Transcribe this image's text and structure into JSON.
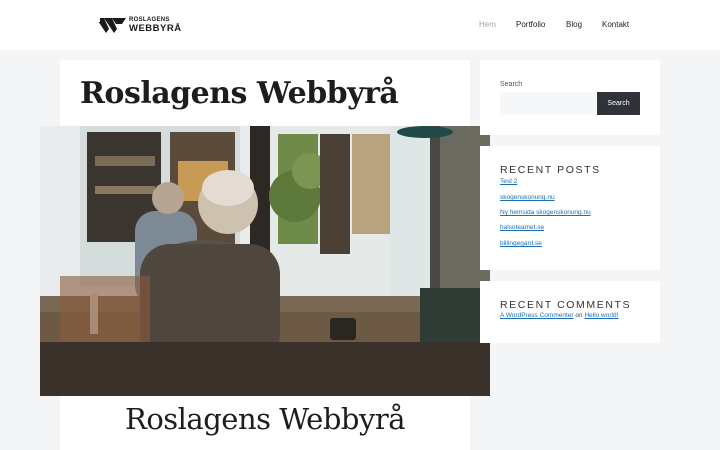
{
  "header": {
    "logo": {
      "top": "ROSLAGENS",
      "bottom": "WEBBYRÅ"
    },
    "nav": [
      {
        "label": "Hem",
        "active": true
      },
      {
        "label": "Portfolio",
        "active": false
      },
      {
        "label": "Blog",
        "active": false
      },
      {
        "label": "Kontakt",
        "active": false
      }
    ]
  },
  "main": {
    "title": "Roslagens Webbyrå",
    "bottom_title": "Roslagens Webbyrå"
  },
  "sidebar": {
    "search": {
      "label": "Search",
      "button": "Search",
      "value": ""
    },
    "recent_posts": {
      "heading": "RECENT POSTS",
      "items": [
        "Test 2",
        "skogenskonung.nu",
        "Ny hemsida skogenskonung.nu",
        "halsoteamet.se",
        "billingegard.se"
      ]
    },
    "recent_comments": {
      "heading": "RECENT COMMENTS",
      "author": "A WordPress Commenter",
      "on": "on",
      "post": "Hello world!"
    }
  },
  "colors": {
    "page_bg": "#f4f5f7",
    "link": "#1a6fb5",
    "button_bg": "#2e3339",
    "nav_active": "#a0a6ad"
  }
}
